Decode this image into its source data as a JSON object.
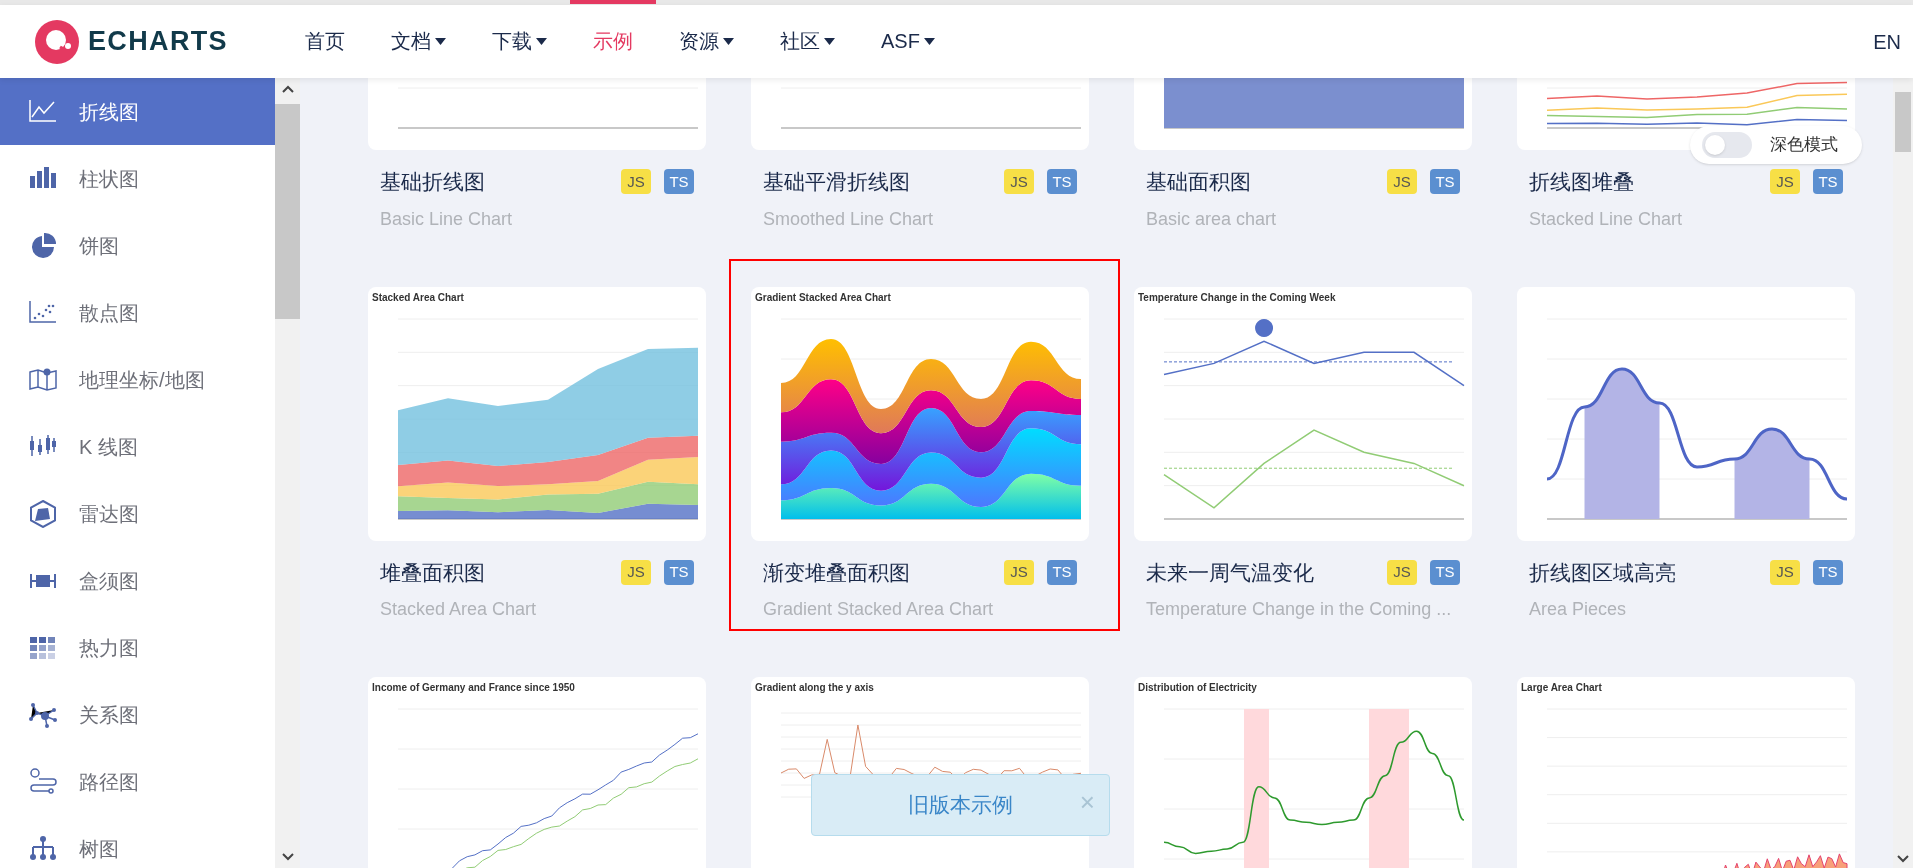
{
  "brand": "ECHARTS",
  "nav": {
    "items": [
      {
        "label": "首页",
        "dropdown": false,
        "selected": false
      },
      {
        "label": "文档",
        "dropdown": true,
        "selected": false
      },
      {
        "label": "下载",
        "dropdown": true,
        "selected": false
      },
      {
        "label": "示例",
        "dropdown": false,
        "selected": true
      },
      {
        "label": "资源",
        "dropdown": true,
        "selected": false
      },
      {
        "label": "社区",
        "dropdown": true,
        "selected": false
      },
      {
        "label": "ASF",
        "dropdown": true,
        "selected": false
      }
    ],
    "lang": "EN"
  },
  "sidebar": {
    "items": [
      {
        "label": "折线图",
        "kind": "line",
        "selected": true
      },
      {
        "label": "柱状图",
        "kind": "bar",
        "selected": false
      },
      {
        "label": "饼图",
        "kind": "pie",
        "selected": false
      },
      {
        "label": "散点图",
        "kind": "scatter",
        "selected": false
      },
      {
        "label": "地理坐标/地图",
        "kind": "map",
        "selected": false
      },
      {
        "label": "K 线图",
        "kind": "candlestick",
        "selected": false
      },
      {
        "label": "雷达图",
        "kind": "radar",
        "selected": false
      },
      {
        "label": "盒须图",
        "kind": "boxplot",
        "selected": false
      },
      {
        "label": "热力图",
        "kind": "heatmap",
        "selected": false
      },
      {
        "label": "关系图",
        "kind": "graph",
        "selected": false
      },
      {
        "label": "路径图",
        "kind": "lines",
        "selected": false
      },
      {
        "label": "树图",
        "kind": "tree",
        "selected": false
      }
    ]
  },
  "dark_mode": {
    "label": "深色模式",
    "on": false
  },
  "examples": [
    {
      "kind": "basic-line",
      "title": "基础折线图",
      "subtitle": "Basic Line Chart",
      "tags": [
        "JS",
        "TS"
      ],
      "highlighted": false
    },
    {
      "kind": "smooth-line",
      "title": "基础平滑折线图",
      "subtitle": "Smoothed Line Chart",
      "tags": [
        "JS",
        "TS"
      ],
      "highlighted": false
    },
    {
      "kind": "area",
      "title": "基础面积图",
      "subtitle": "Basic area chart",
      "tags": [
        "JS",
        "TS"
      ],
      "highlighted": false
    },
    {
      "kind": "stacked-line",
      "title": "折线图堆叠",
      "subtitle": "Stacked Line Chart",
      "tags": [
        "JS",
        "TS"
      ],
      "highlighted": false
    },
    {
      "kind": "stacked-area",
      "chart_title": "Stacked Area Chart",
      "title": "堆叠面积图",
      "subtitle": "Stacked Area Chart",
      "tags": [
        "JS",
        "TS"
      ],
      "highlighted": false
    },
    {
      "kind": "gradient-stacked",
      "chart_title": "Gradient Stacked Area Chart",
      "title": "渐变堆叠面积图",
      "subtitle": "Gradient Stacked Area Chart",
      "tags": [
        "JS",
        "TS"
      ],
      "highlighted": true
    },
    {
      "kind": "temperature",
      "chart_title": "Temperature Change in the Coming Week",
      "title": "未来一周气温变化",
      "subtitle": "Temperature Change in the Coming ...",
      "tags": [
        "JS",
        "TS"
      ],
      "highlighted": false
    },
    {
      "kind": "area-pieces",
      "title": "折线图区域高亮",
      "subtitle": "Area Pieces",
      "tags": [
        "JS",
        "TS"
      ],
      "highlighted": false
    },
    {
      "kind": "income",
      "chart_title": "Income of Germany and France since 1950",
      "highlighted": false
    },
    {
      "kind": "gradient-y",
      "chart_title": "Gradient along the y axis",
      "highlighted": false
    },
    {
      "kind": "electricity",
      "chart_title": "Distribution of Electricity",
      "highlighted": false
    },
    {
      "kind": "large-area",
      "chart_title": "Large Area Chart",
      "highlighted": false
    }
  ],
  "notice": {
    "text": "旧版本示例",
    "close": "×"
  }
}
